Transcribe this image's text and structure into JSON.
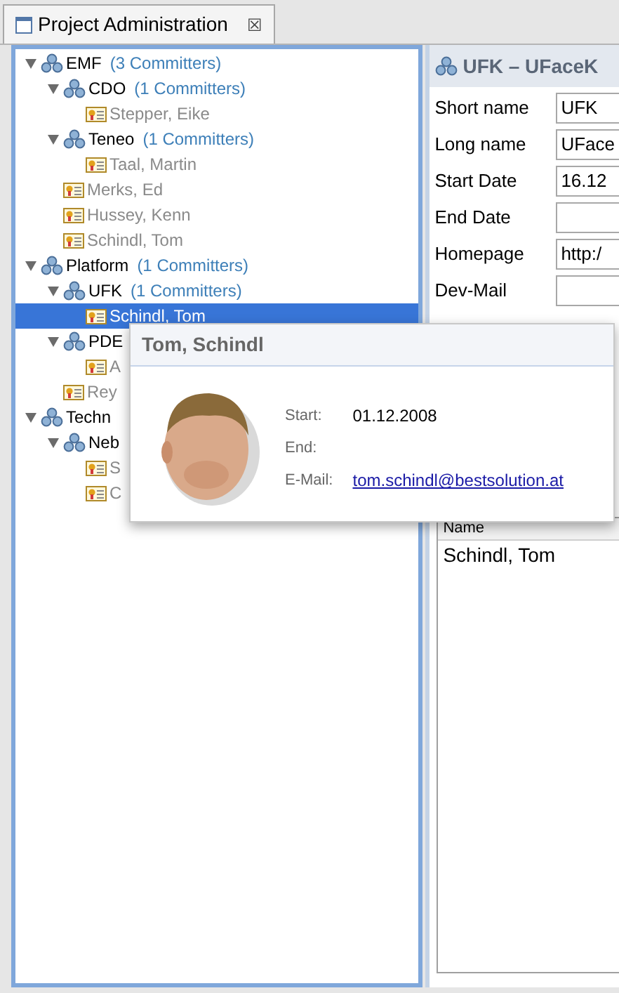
{
  "view_tab": {
    "title": "Project Administration",
    "close": "☒"
  },
  "tree": [
    {
      "kind": "group",
      "label": "EMF",
      "count": "(3 Committers)",
      "expanded": true,
      "selected": false,
      "children": [
        {
          "kind": "group",
          "label": "CDO",
          "count": "(1 Committers)",
          "expanded": true,
          "selected": false,
          "children": [
            {
              "kind": "person",
              "label": "Stepper, Eike",
              "selected": false
            }
          ]
        },
        {
          "kind": "group",
          "label": "Teneo",
          "count": "(1 Committers)",
          "expanded": true,
          "selected": false,
          "children": [
            {
              "kind": "person",
              "label": "Taal, Martin",
              "selected": false
            }
          ]
        },
        {
          "kind": "person",
          "label": "Merks, Ed",
          "selected": false
        },
        {
          "kind": "person",
          "label": "Hussey, Kenn",
          "selected": false
        },
        {
          "kind": "person",
          "label": "Schindl, Tom",
          "selected": false
        }
      ]
    },
    {
      "kind": "group",
      "label": "Platform",
      "count": "(1 Committers)",
      "expanded": true,
      "selected": false,
      "children": [
        {
          "kind": "group",
          "label": "UFK",
          "count": "(1 Committers)",
          "expanded": true,
          "selected": false,
          "children": [
            {
              "kind": "person",
              "label": "Schindl, Tom",
              "selected": true
            }
          ]
        },
        {
          "kind": "group",
          "label": "PDE",
          "expanded": true,
          "selected": false,
          "children": [
            {
              "kind": "person",
              "label": "A",
              "selected": false
            }
          ]
        },
        {
          "kind": "person",
          "label": "Rey",
          "selected": false
        }
      ]
    },
    {
      "kind": "group",
      "label": "Techn",
      "expanded": true,
      "selected": false,
      "children": [
        {
          "kind": "group",
          "label": "Neb",
          "expanded": true,
          "selected": false,
          "children": [
            {
              "kind": "person",
              "label": "S",
              "selected": false
            },
            {
              "kind": "person",
              "label": "C",
              "selected": false
            }
          ]
        }
      ]
    }
  ],
  "detail": {
    "title": "UFK – UFaceK",
    "fields": [
      {
        "label": "Short name",
        "value": "UFK"
      },
      {
        "label": "Long name",
        "value": "UFace"
      },
      {
        "label": "Start Date",
        "value": "16.12"
      },
      {
        "label": "End Date"
      },
      {
        "label": "Homepage",
        "value": "http:/"
      },
      {
        "label": "Dev-Mail"
      }
    ],
    "table": {
      "columns": [
        "Name"
      ],
      "rows": [
        [
          "Schindl, Tom"
        ]
      ]
    }
  },
  "tooltip": {
    "title": "Tom, Schindl",
    "rows": [
      {
        "label": "Start:",
        "value": "01.12.2008"
      },
      {
        "label": "End:"
      },
      {
        "label": "E-Mail:",
        "value": "tom.schindl@bestsolution.at",
        "kind": "link"
      }
    ]
  }
}
